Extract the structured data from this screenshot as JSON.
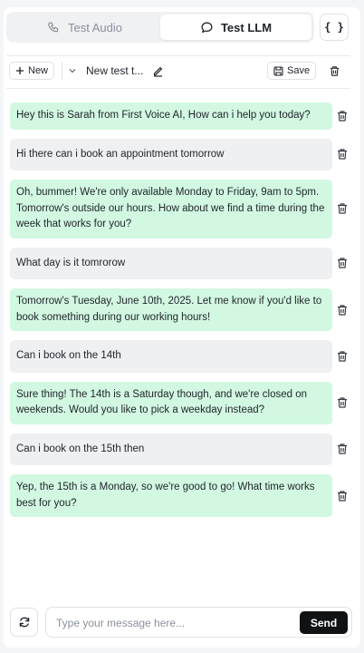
{
  "tabs": [
    {
      "label": "Test Audio",
      "icon": "phone-icon",
      "active": false
    },
    {
      "label": "Test LLM",
      "icon": "chat-bubble-icon",
      "active": true
    }
  ],
  "json_button": {
    "label": "{ }"
  },
  "toolbar": {
    "new_label": "New",
    "test_name": "New test t...",
    "save_label": "Save"
  },
  "messages": [
    {
      "role": "bot",
      "text": "Hey this is Sarah from First Voice AI, How can i help you today?"
    },
    {
      "role": "user",
      "text": "Hi there can i book an appointment tomorrow"
    },
    {
      "role": "bot",
      "text": "Oh, bummer! We're only available Monday to Friday, 9am to 5pm. Tomorrow's outside our hours. How about we find a time during the week that works for you?"
    },
    {
      "role": "user",
      "text": "What day is it tomrorow"
    },
    {
      "role": "bot",
      "text": "Tomorrow's Tuesday, June 10th, 2025. Let me know if you'd like to book something during our working hours!"
    },
    {
      "role": "user",
      "text": "Can i book on the 14th"
    },
    {
      "role": "bot",
      "text": "Sure thing! The 14th is a Saturday though, and we're closed on weekends. Would you like to pick a weekday instead?"
    },
    {
      "role": "user",
      "text": "Can i book on the 15th then"
    },
    {
      "role": "bot",
      "text": "Yep, the 15th is a Monday, so we're good to go! What time works best for you?"
    }
  ],
  "composer": {
    "placeholder": "Type your message here...",
    "value": "",
    "send_label": "Send"
  },
  "colors": {
    "bot_bubble": "#d2f8e2",
    "user_bubble": "#eff0f2",
    "send_button": "#111214"
  }
}
